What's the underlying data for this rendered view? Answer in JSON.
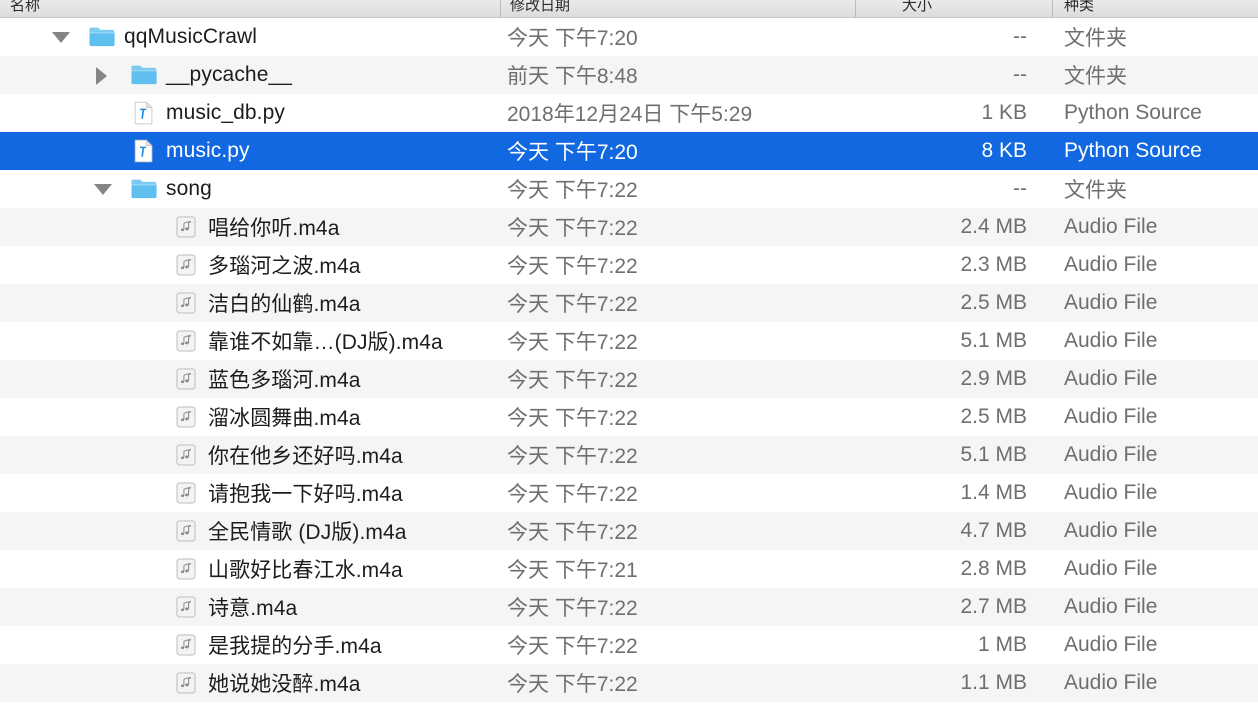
{
  "window": {
    "title": "qqMusicCrawl"
  },
  "columns": {
    "name": "名称",
    "date_modified": "修改日期",
    "size": "大小",
    "kind": "种类"
  },
  "colors": {
    "selection_blue": "#1268e0",
    "row_alt": "#f4f5f5",
    "row_base": "#ffffff",
    "header_bg": "#e2e2e2",
    "secondary_text": "#6e6e73",
    "folder_blue": "#64c3f0"
  },
  "rows": [
    {
      "name": "qqMusicCrawl",
      "date": "今天 下午7:20",
      "size": "--",
      "kind": "文件夹",
      "icon": "folder-icon",
      "level": 1,
      "twisty": "open",
      "selected": false,
      "stripe": "base"
    },
    {
      "name": "__pycache__",
      "date": "前天 下午8:48",
      "size": "--",
      "kind": "文件夹",
      "icon": "folder-icon",
      "level": 2,
      "twisty": "closed",
      "selected": false,
      "stripe": "alt"
    },
    {
      "name": "music_db.py",
      "date": "2018年12月24日 下午5:29",
      "size": "1 KB",
      "kind": "Python Source",
      "icon": "python-source-icon",
      "level": 2,
      "twisty": "none",
      "selected": false,
      "stripe": "base"
    },
    {
      "name": "music.py",
      "date": "今天 下午7:20",
      "size": "8 KB",
      "kind": "Python Source",
      "icon": "python-source-icon",
      "level": 2,
      "twisty": "none",
      "selected": true,
      "stripe": "base"
    },
    {
      "name": "song",
      "date": "今天 下午7:22",
      "size": "--",
      "kind": "文件夹",
      "icon": "folder-icon",
      "level": 2,
      "twisty": "open",
      "selected": false,
      "stripe": "base"
    },
    {
      "name": "唱给你听.m4a",
      "date": "今天 下午7:22",
      "size": "2.4 MB",
      "kind": "Audio File",
      "icon": "audio-file-icon",
      "level": 3,
      "twisty": "none",
      "selected": false,
      "stripe": "alt"
    },
    {
      "name": "多瑙河之波.m4a",
      "date": "今天 下午7:22",
      "size": "2.3 MB",
      "kind": "Audio File",
      "icon": "audio-file-icon",
      "level": 3,
      "twisty": "none",
      "selected": false,
      "stripe": "base"
    },
    {
      "name": "洁白的仙鹤.m4a",
      "date": "今天 下午7:22",
      "size": "2.5 MB",
      "kind": "Audio File",
      "icon": "audio-file-icon",
      "level": 3,
      "twisty": "none",
      "selected": false,
      "stripe": "alt"
    },
    {
      "name": "靠谁不如靠…(DJ版).m4a",
      "date": "今天 下午7:22",
      "size": "5.1 MB",
      "kind": "Audio File",
      "icon": "audio-file-icon",
      "level": 3,
      "twisty": "none",
      "selected": false,
      "stripe": "base"
    },
    {
      "name": "蓝色多瑙河.m4a",
      "date": "今天 下午7:22",
      "size": "2.9 MB",
      "kind": "Audio File",
      "icon": "audio-file-icon",
      "level": 3,
      "twisty": "none",
      "selected": false,
      "stripe": "alt"
    },
    {
      "name": "溜冰圆舞曲.m4a",
      "date": "今天 下午7:22",
      "size": "2.5 MB",
      "kind": "Audio File",
      "icon": "audio-file-icon",
      "level": 3,
      "twisty": "none",
      "selected": false,
      "stripe": "base"
    },
    {
      "name": "你在他乡还好吗.m4a",
      "date": "今天 下午7:22",
      "size": "5.1 MB",
      "kind": "Audio File",
      "icon": "audio-file-icon",
      "level": 3,
      "twisty": "none",
      "selected": false,
      "stripe": "alt"
    },
    {
      "name": "请抱我一下好吗.m4a",
      "date": "今天 下午7:22",
      "size": "1.4 MB",
      "kind": "Audio File",
      "icon": "audio-file-icon",
      "level": 3,
      "twisty": "none",
      "selected": false,
      "stripe": "base"
    },
    {
      "name": "全民情歌 (DJ版).m4a",
      "date": "今天 下午7:22",
      "size": "4.7 MB",
      "kind": "Audio File",
      "icon": "audio-file-icon",
      "level": 3,
      "twisty": "none",
      "selected": false,
      "stripe": "alt"
    },
    {
      "name": "山歌好比春江水.m4a",
      "date": "今天 下午7:21",
      "size": "2.8 MB",
      "kind": "Audio File",
      "icon": "audio-file-icon",
      "level": 3,
      "twisty": "none",
      "selected": false,
      "stripe": "base"
    },
    {
      "name": "诗意.m4a",
      "date": "今天 下午7:22",
      "size": "2.7 MB",
      "kind": "Audio File",
      "icon": "audio-file-icon",
      "level": 3,
      "twisty": "none",
      "selected": false,
      "stripe": "alt"
    },
    {
      "name": "是我提的分手.m4a",
      "date": "今天 下午7:22",
      "size": "1 MB",
      "kind": "Audio File",
      "icon": "audio-file-icon",
      "level": 3,
      "twisty": "none",
      "selected": false,
      "stripe": "base"
    },
    {
      "name": "她说她没醉.m4a",
      "date": "今天 下午7:22",
      "size": "1.1 MB",
      "kind": "Audio File",
      "icon": "audio-file-icon",
      "level": 3,
      "twisty": "none",
      "selected": false,
      "stripe": "alt"
    }
  ]
}
